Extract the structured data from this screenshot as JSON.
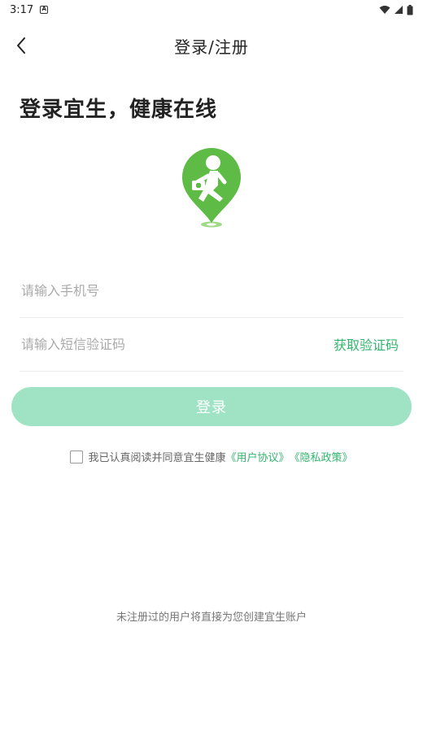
{
  "status_bar": {
    "time": "3:17",
    "notification_icon": "a-icon",
    "wifi_icon": "wifi-icon",
    "signal_icon": "signal-icon",
    "battery_icon": "battery-icon"
  },
  "header": {
    "title": "登录/注册",
    "back_icon": "chevron-left-icon"
  },
  "slogan": "登录宜生，健康在线",
  "logo": {
    "icon": "runner-map-pin-logo",
    "color": "#5dbb46"
  },
  "form": {
    "phone_placeholder": "请输入手机号",
    "code_placeholder": "请输入短信验证码",
    "get_code_label": "获取验证码"
  },
  "login_button": {
    "label": "登录",
    "color": "#9fe3c4"
  },
  "agreement": {
    "prefix": "我已认真阅读并同意宜生健康",
    "user_agreement": "《用户协议》",
    "privacy_policy": "《隐私政策》"
  },
  "footer_note": "未注册过的用户将直接为您创建宜生账户",
  "colors": {
    "accent": "#33b56e"
  }
}
